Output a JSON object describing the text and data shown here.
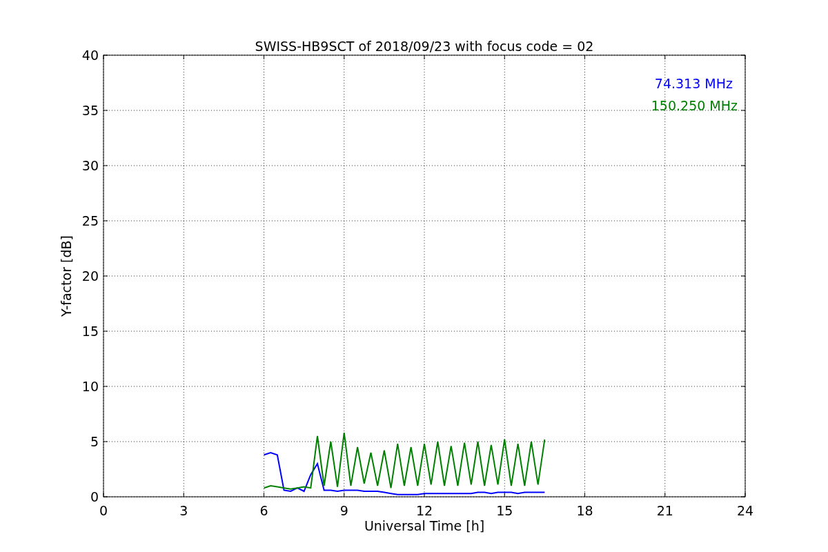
{
  "chart_data": {
    "type": "line",
    "title": "SWISS-HB9SCT of 2018/09/23 with focus code = 02",
    "xlabel": "Universal Time [h]",
    "ylabel": "Y-factor [dB]",
    "x": [
      6,
      6.25,
      6.5,
      6.75,
      7,
      7.25,
      7.5,
      7.75,
      8,
      8.25,
      8.5,
      8.75,
      9,
      9.25,
      9.5,
      9.75,
      10,
      10.25,
      10.5,
      10.75,
      11,
      11.25,
      11.5,
      11.75,
      12,
      12.25,
      12.5,
      12.75,
      13,
      13.25,
      13.5,
      13.75,
      14,
      14.25,
      14.5,
      14.75,
      15,
      15.25,
      15.5,
      15.75,
      16,
      16.25,
      16.5
    ],
    "series": [
      {
        "name": "74.313 MHz",
        "color": "#0000ff",
        "values": [
          3.8,
          4.0,
          3.8,
          0.6,
          0.5,
          0.8,
          0.5,
          2.0,
          3.0,
          0.6,
          0.6,
          0.5,
          0.6,
          0.6,
          0.6,
          0.5,
          0.5,
          0.5,
          0.4,
          0.3,
          0.2,
          0.2,
          0.2,
          0.2,
          0.3,
          0.3,
          0.3,
          0.3,
          0.3,
          0.3,
          0.3,
          0.3,
          0.4,
          0.4,
          0.3,
          0.4,
          0.4,
          0.4,
          0.3,
          0.4,
          0.4,
          0.4,
          0.4
        ]
      },
      {
        "name": "150.250 MHz",
        "color": "#008000",
        "values": [
          0.8,
          1.0,
          0.9,
          0.8,
          0.7,
          0.8,
          0.9,
          0.8,
          5.5,
          1.0,
          5.0,
          0.9,
          5.8,
          1.0,
          4.5,
          1.2,
          4.0,
          1.0,
          4.2,
          0.8,
          4.8,
          1.0,
          4.5,
          1.0,
          4.8,
          1.1,
          5.0,
          1.0,
          4.6,
          1.0,
          4.9,
          1.1,
          5.0,
          1.0,
          4.7,
          1.1,
          5.2,
          1.0,
          4.8,
          1.0,
          5.0,
          1.1,
          5.2
        ]
      }
    ],
    "grid": true,
    "xlim": [
      0,
      24
    ],
    "ylim": [
      0,
      40
    ],
    "xticks": [
      0,
      3,
      6,
      9,
      12,
      15,
      18,
      21,
      24
    ],
    "yticks": [
      0,
      5,
      10,
      15,
      20,
      25,
      30,
      35,
      40
    ]
  }
}
